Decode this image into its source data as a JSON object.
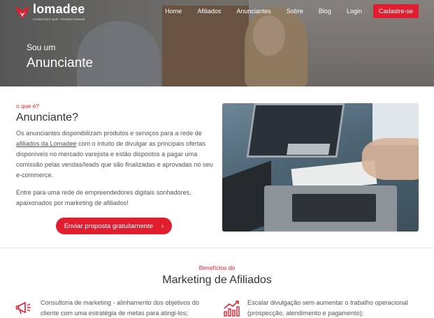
{
  "brand": {
    "name": "lomadee",
    "tagline": "CONEXÕES QUE TRANSFORMAM",
    "accent": "#e01e2f"
  },
  "nav": {
    "items": [
      "Home",
      "Afiliados",
      "Anunciantes",
      "Sobre",
      "Blog",
      "Login"
    ],
    "signup": "Cadastre-se"
  },
  "hero": {
    "subtitle": "Sou um",
    "title": "Anunciante"
  },
  "intro": {
    "kicker": "o que é?",
    "title": "Anunciante?",
    "para1_before": "Os anunciantes disponibilizam produtos e serviços para a rede de ",
    "para1_link": "afiliados da Lomadee",
    "para1_after": " com o intuito de divulgar as principais ofertas disponíveis no mercado varejista e estão dispostos a pagar uma comissão pelas vendas/leads que são finalizadas e aprovadas no seu e-commerce.",
    "para2": "Entre para uma rede de empreendedores digitais sonhadores, apaixonados por marketing de afiliados!",
    "cta": "Enviar proposta gratuitamente",
    "cta_icon": "chevron-right-icon"
  },
  "benefits": {
    "kicker": "Benefícios do",
    "title": "Marketing de Afiliados",
    "items": [
      {
        "icon": "megaphone-icon",
        "text": "Consultoria de marketing - alinhamento dos objetivos do cliente com uma estratégia de metas para atingi-los;"
      },
      {
        "icon": "growth-chart-icon",
        "text": "Escalar divulgação sem aumentar o trabalho operacional (prospecção, atendimento e pagamento);"
      }
    ]
  }
}
